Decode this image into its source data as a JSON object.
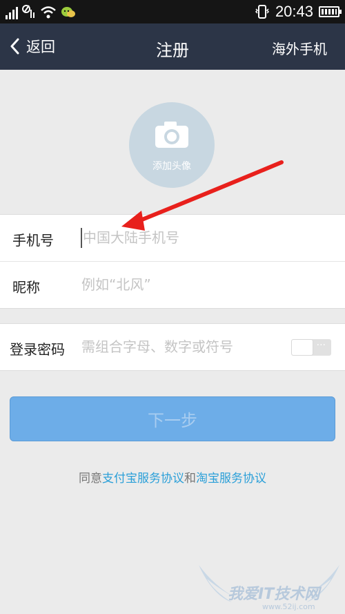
{
  "status_bar": {
    "time": "20:43",
    "icons": [
      "signal-icon",
      "data-icon",
      "wifi-icon",
      "wechat-icon",
      "vibrate-icon",
      "battery-icon"
    ]
  },
  "nav": {
    "back_label": "返回",
    "title": "注册",
    "right_label": "海外手机"
  },
  "avatar": {
    "label": "添加头像",
    "icon": "camera-icon"
  },
  "form": {
    "phone": {
      "label": "手机号",
      "placeholder": "中国大陆手机号",
      "value": ""
    },
    "nickname": {
      "label": "昵称",
      "placeholder": "例如“北风”",
      "value": ""
    },
    "password": {
      "label": "登录密码",
      "placeholder": "需组合字母、数字或符号",
      "value": "",
      "show_toggle": "off"
    }
  },
  "next_button": {
    "label": "下一步"
  },
  "agreement": {
    "prefix": "同意",
    "link1": "支付宝服务协议",
    "conjunction": "和",
    "link2": "淘宝服务协议"
  },
  "watermark": {
    "text": "我爱IT技术网",
    "url": "www.52ij.com"
  },
  "colors": {
    "nav_bg": "#2c3547",
    "accent_button": "#6dade8",
    "link": "#2a9fd8",
    "annotation_arrow": "#e8201c"
  }
}
